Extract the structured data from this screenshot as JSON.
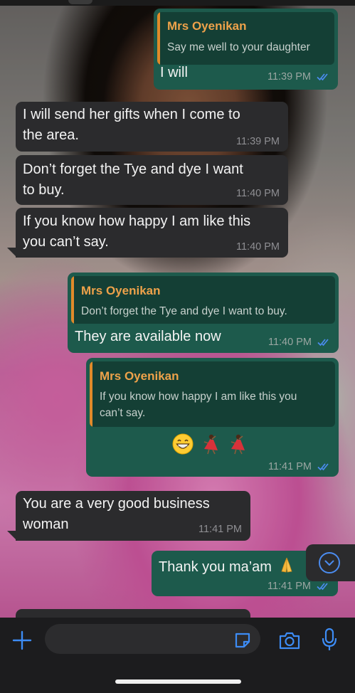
{
  "colors": {
    "outgoing_bubble": "#1d5a4c",
    "incoming_bubble": "#2b2b2d",
    "quote_author": "#eea24a",
    "read_ticks": "#4b8cf0"
  },
  "messages": [
    {
      "direction": "outgoing",
      "quoted": {
        "author": "Mrs Oyenikan",
        "text": "Say me well to your daughter"
      },
      "text": "I will",
      "time": "11:39 PM",
      "status": "read"
    },
    {
      "direction": "incoming",
      "lines": [
        "I will send her gifts when I come to",
        "the area."
      ],
      "time": "11:39 PM"
    },
    {
      "direction": "incoming",
      "lines": [
        "Don’t forget the Tye and dye I want",
        "to buy."
      ],
      "time": "11:40 PM"
    },
    {
      "direction": "incoming",
      "lines": [
        "If you know how happy I am like this",
        "you can’t say."
      ],
      "time": "11:40 PM"
    },
    {
      "direction": "outgoing",
      "quoted": {
        "author": "Mrs Oyenikan",
        "text": "Don’t forget the Tye and dye I want to buy."
      },
      "text": "They are available now",
      "time": "11:40 PM",
      "status": "read"
    },
    {
      "direction": "outgoing",
      "quoted": {
        "author": "Mrs Oyenikan",
        "lines": [
          "If you know how happy I am like this you",
          "can’t say."
        ]
      },
      "emojis": [
        "grinning-face",
        "woman-dancing",
        "woman-dancing"
      ],
      "time": "11:41 PM",
      "status": "read"
    },
    {
      "direction": "incoming",
      "lines": [
        "You are a very good business",
        "woman"
      ],
      "time": "11:41 PM"
    },
    {
      "direction": "outgoing",
      "text": "Thank you ma’am",
      "emoji": "folded-hands",
      "time": "11:41 PM",
      "status": "read"
    }
  ],
  "composer": {
    "icons": [
      "plus-icon",
      "sticker-icon",
      "camera-icon",
      "microphone-icon"
    ]
  },
  "scroll_button_icon": "chevron-down-circle-icon"
}
